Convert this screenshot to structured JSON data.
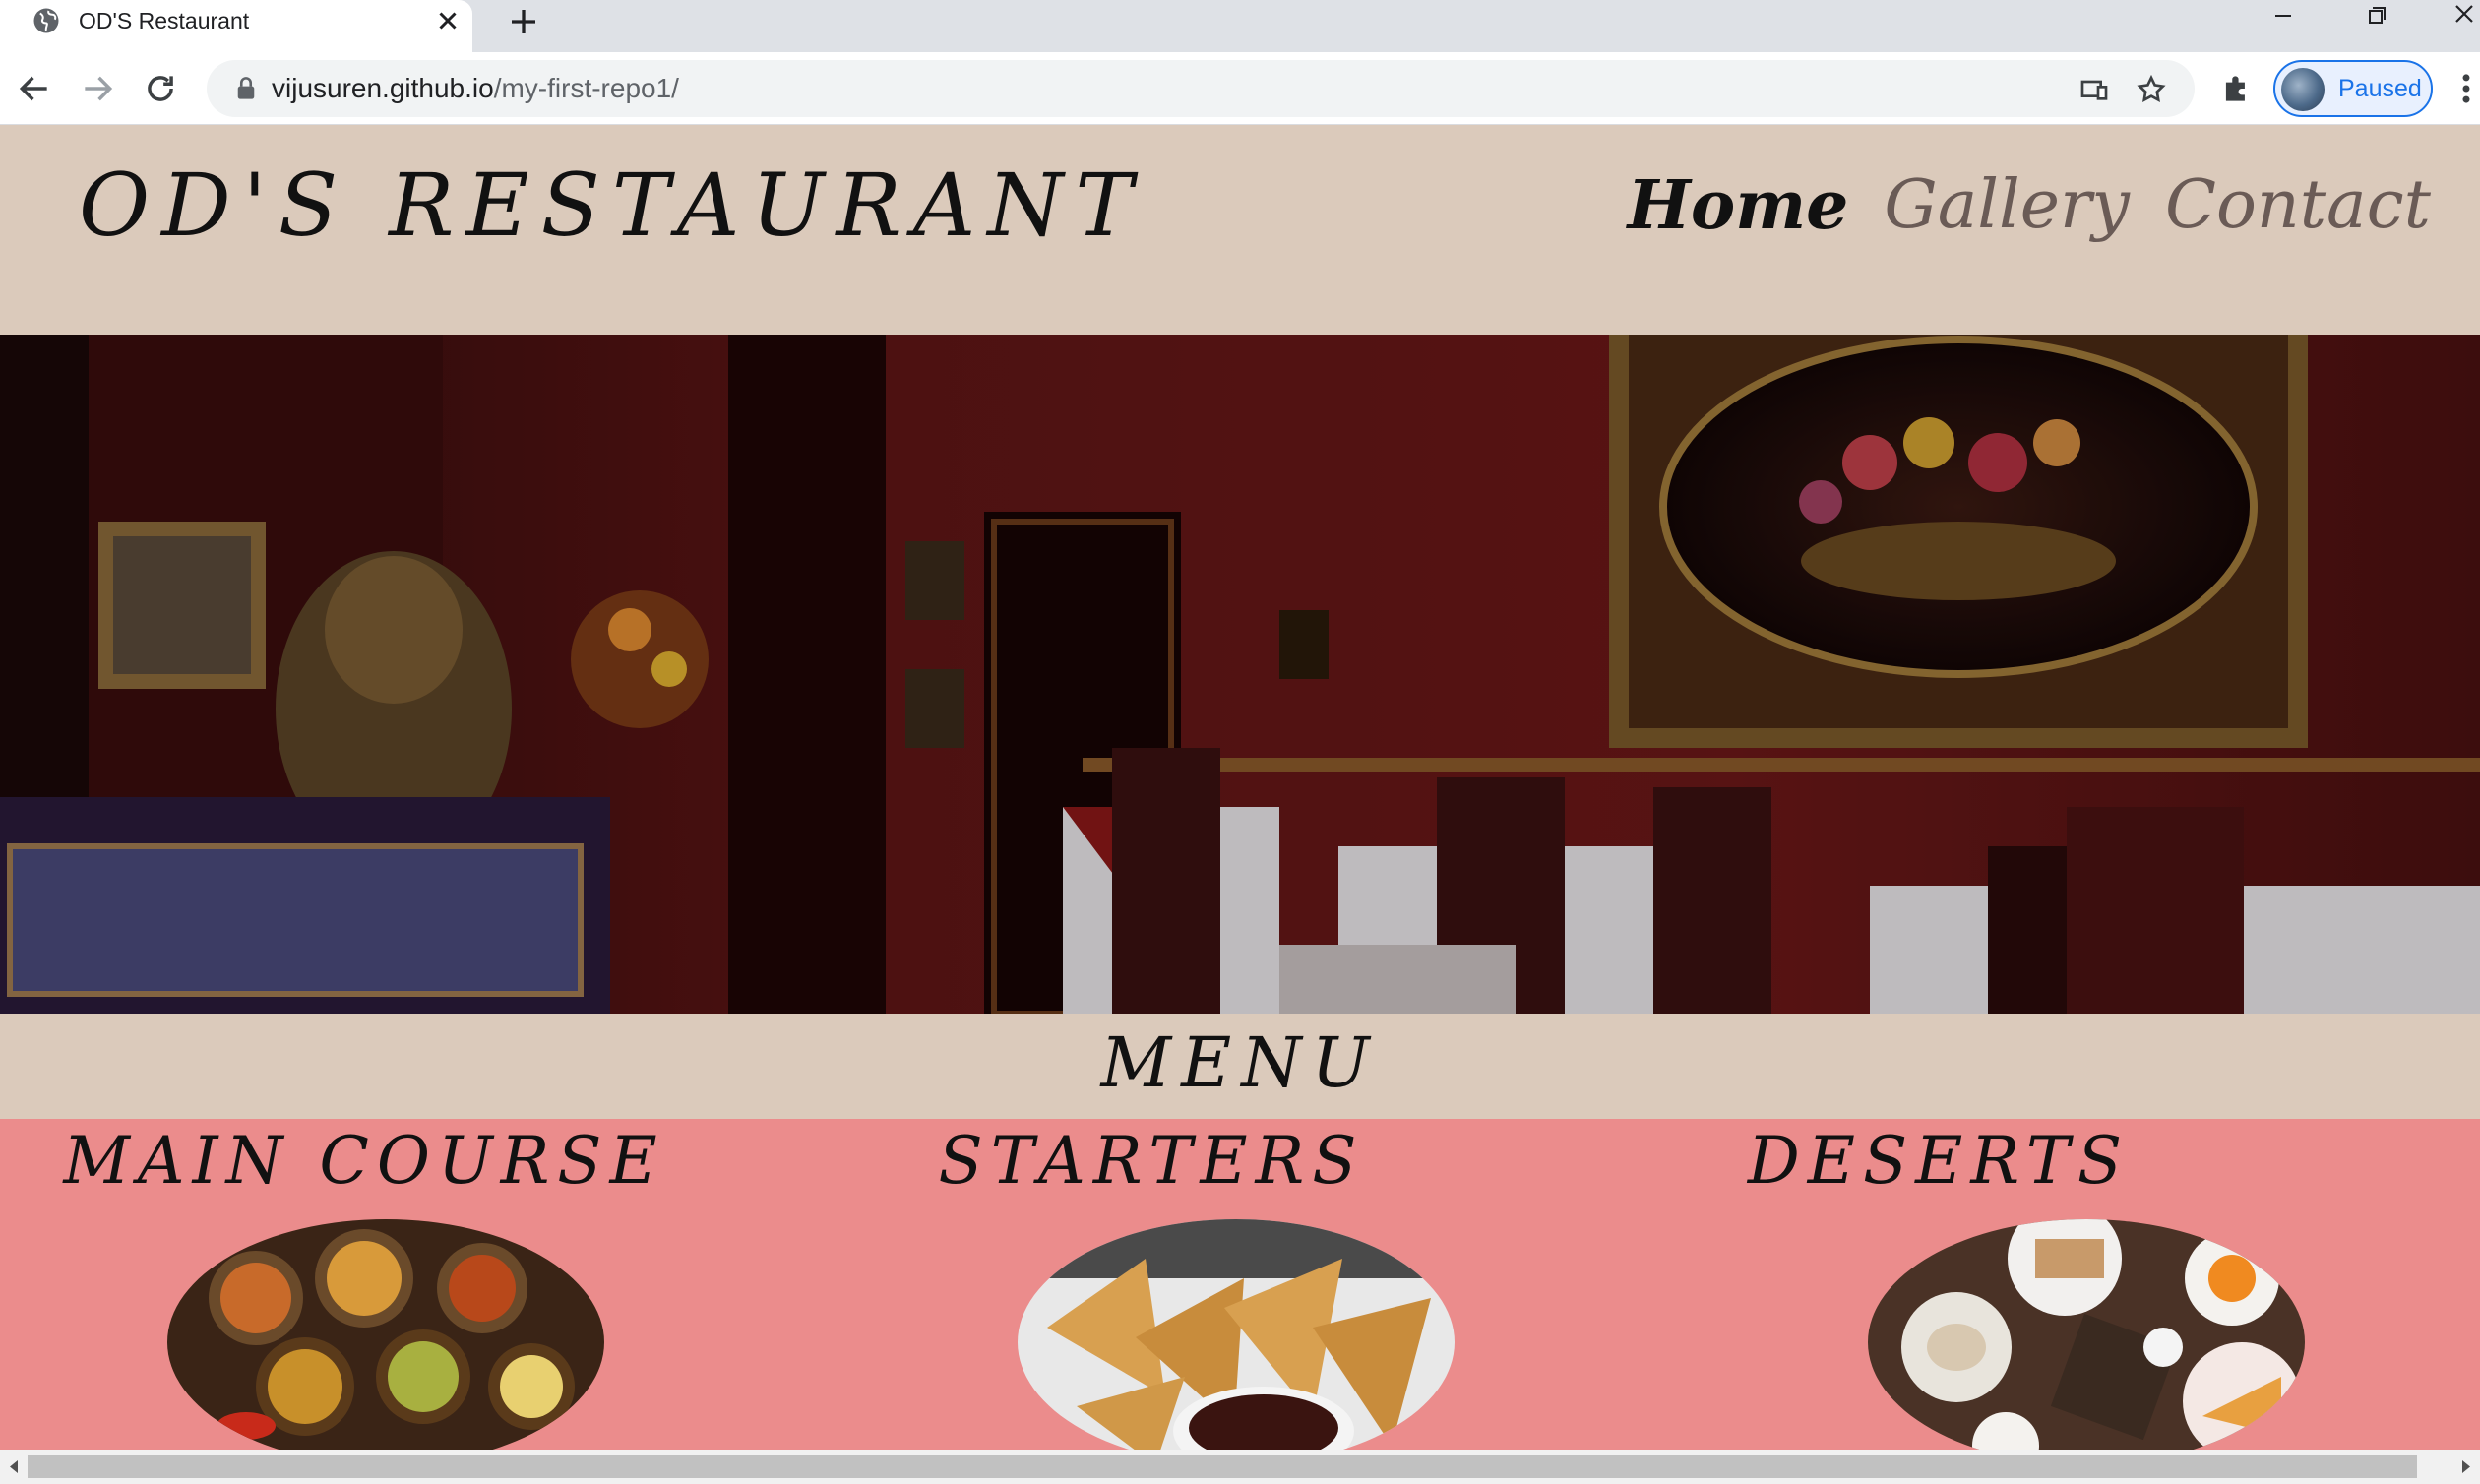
{
  "browser": {
    "tab": {
      "title": "OD'S Restaurant"
    },
    "address": {
      "host": "vijusuren.github.io",
      "path": "/my-first-repo1/"
    },
    "profile": {
      "label": "Paused"
    }
  },
  "site": {
    "logo": "OD'S RESTAURANT",
    "nav": [
      {
        "label": "Home",
        "active": true
      },
      {
        "label": "Gallery",
        "active": false
      },
      {
        "label": "Contact",
        "active": false
      }
    ],
    "menu_heading": "MENU",
    "categories": [
      {
        "title": "MAIN COURSE",
        "image": "curry-platter"
      },
      {
        "title": "STARTERS",
        "image": "samosa-plate"
      },
      {
        "title": "DESERTS",
        "image": "dessert-table"
      }
    ],
    "colors": {
      "header_bg": "#dbcabb",
      "menu_section_bg": "#eb8c8c",
      "text": "#111111",
      "nav_inactive": "#6a5b56"
    }
  }
}
